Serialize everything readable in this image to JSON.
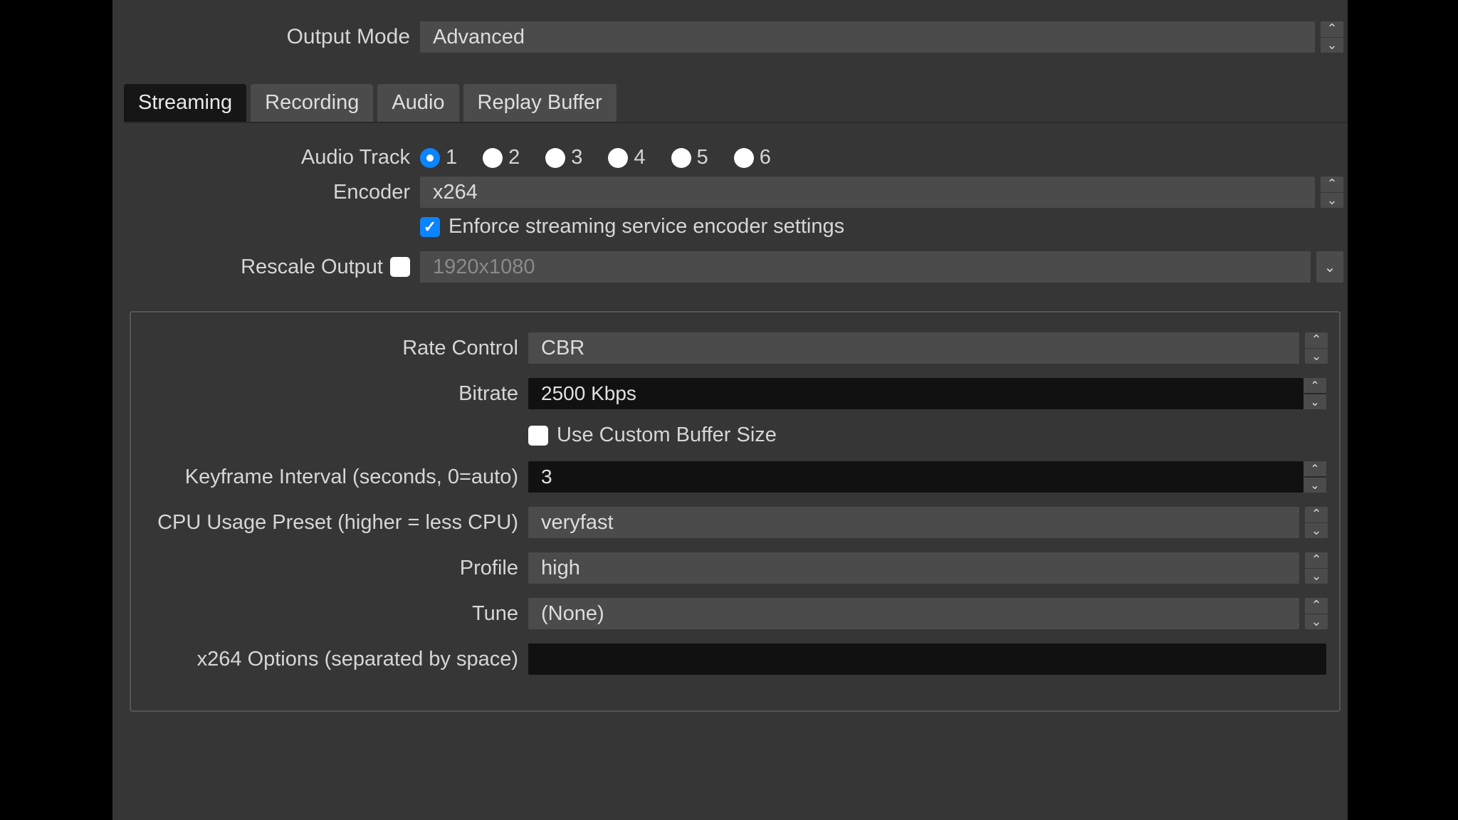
{
  "outputMode": {
    "label": "Output Mode",
    "value": "Advanced"
  },
  "tabs": [
    "Streaming",
    "Recording",
    "Audio",
    "Replay Buffer"
  ],
  "activeTab": "Streaming",
  "audioTrack": {
    "label": "Audio Track",
    "options": [
      "1",
      "2",
      "3",
      "4",
      "5",
      "6"
    ],
    "selected": "1"
  },
  "encoder": {
    "label": "Encoder",
    "value": "x264"
  },
  "enforce": {
    "label": "Enforce streaming service encoder settings",
    "checked": true
  },
  "rescale": {
    "label": "Rescale Output",
    "checked": false,
    "placeholder": "1920x1080"
  },
  "encoderSettings": {
    "rateControl": {
      "label": "Rate Control",
      "value": "CBR"
    },
    "bitrate": {
      "label": "Bitrate",
      "value": "2500 Kbps"
    },
    "customBuffer": {
      "label": "Use Custom Buffer Size",
      "checked": false
    },
    "keyframe": {
      "label": "Keyframe Interval (seconds, 0=auto)",
      "value": "3"
    },
    "cpuPreset": {
      "label": "CPU Usage Preset (higher = less CPU)",
      "value": "veryfast"
    },
    "profile": {
      "label": "Profile",
      "value": "high"
    },
    "tune": {
      "label": "Tune",
      "value": "(None)"
    },
    "x264opts": {
      "label": "x264 Options (separated by space)",
      "value": ""
    }
  }
}
